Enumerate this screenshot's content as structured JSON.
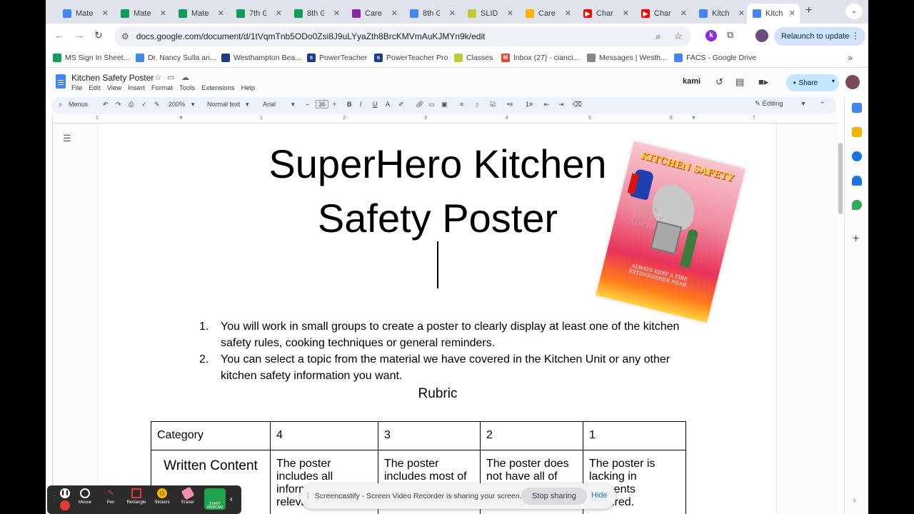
{
  "browser": {
    "tabs": [
      {
        "label": "Mate",
        "icon": "drive-icon",
        "color": "#4285f4"
      },
      {
        "label": "Mate",
        "icon": "sheets-icon",
        "color": "#0f9d58"
      },
      {
        "label": "Mate",
        "icon": "sheets-icon",
        "color": "#0f9d58"
      },
      {
        "label": "7th G",
        "icon": "sheets-icon",
        "color": "#0f9d58"
      },
      {
        "label": "8th G",
        "icon": "sheets-icon",
        "color": "#0f9d58"
      },
      {
        "label": "Care",
        "icon": "classroom-icon",
        "color": "#8e24aa"
      },
      {
        "label": "8th G",
        "icon": "docs-icon",
        "color": "#4285f4"
      },
      {
        "label": "SLIDI",
        "icon": "classes-icon",
        "color": "#c0ca33"
      },
      {
        "label": "Care",
        "icon": "slides-icon",
        "color": "#f4b400"
      },
      {
        "label": "Char",
        "icon": "youtube-icon",
        "color": "#ff0000"
      },
      {
        "label": "Char",
        "icon": "youtube-icon",
        "color": "#ff0000"
      },
      {
        "label": "Kitch",
        "icon": "drive-icon",
        "color": "#4285f4"
      },
      {
        "label": "Kitch",
        "icon": "docs-icon",
        "color": "#4285f4",
        "active": true
      }
    ],
    "url": "docs.google.com/document/d/1tVqmTnb5ODo0Zsi8J9uLYyaZth8BrcKMVmAuKJMYn9k/edit",
    "relaunch_label": "Relaunch to update",
    "bookmarks": [
      {
        "label": "MS Sign In Sheet...",
        "color": "#0f9d58"
      },
      {
        "label": "Dr. Nancy Sulla an...",
        "color": "#4285f4"
      },
      {
        "label": "Westhampton Bea...",
        "color": "#1a3d8f"
      },
      {
        "label": "PowerTeacher",
        "color": "#1a3d8f"
      },
      {
        "label": "PowerTeacher Pro",
        "color": "#1a3d8f"
      },
      {
        "label": "Classes",
        "color": "#c0ca33"
      },
      {
        "label": "Inbox (27) - cianci...",
        "color": "#ea4335"
      },
      {
        "label": "Messages | Westh...",
        "color": "#888888"
      },
      {
        "label": "FACS - Google Drive",
        "color": "#4285f4"
      }
    ]
  },
  "docs": {
    "title": "Kitchen Safety Poster",
    "menu": [
      "File",
      "Edit",
      "View",
      "Insert",
      "Format",
      "Tools",
      "Extensions",
      "Help"
    ],
    "kami_label": "kami",
    "share_label": "Share",
    "toolbar": {
      "menus": "Menus",
      "zoom": "200%",
      "style": "Normal text",
      "font": "Arial",
      "size": "36",
      "mode": "Editing"
    },
    "ruler_numbers": [
      "1",
      "1",
      "2",
      "3",
      "4",
      "5",
      "6",
      "7"
    ]
  },
  "document": {
    "heading_line1": "SuperHero Kitchen",
    "heading_line2": "Safety Poster",
    "poster": {
      "top": "KITCHEN SAFETY",
      "middle": "FIRES AREN'T SUPER",
      "bottom": "ALWAYS KEEP A FIRE EXTINGUISHER NEAR."
    },
    "instructions": [
      {
        "num": "1.",
        "text": "You will work in small groups to create a poster to clearly display at least one of the kitchen safety rules, cooking techniques or  general reminders."
      },
      {
        "num": "2.",
        "text": "You can select a topic from the material we have covered in the Kitchen Unit or any other kitchen safety information you want."
      }
    ],
    "rubric_title": "Rubric",
    "rubric": {
      "headers": [
        "Category",
        "4",
        "3",
        "2",
        "1"
      ],
      "row1": [
        "Written Content",
        "The poster includes all information relevant to the",
        "The poster includes most of information,",
        "The poster does not have all of information.",
        "The poster is lacking in elements required."
      ]
    }
  },
  "screencastify": {
    "tools": [
      "Mouse",
      "Pen",
      "Rectangle",
      "Stickers",
      "Eraser"
    ],
    "webcam_label": "START WEBCAM",
    "banner_text": "Screencastify - Screen Video Recorder is sharing your screen.",
    "stop_label": "Stop sharing",
    "hide_label": "Hide"
  }
}
